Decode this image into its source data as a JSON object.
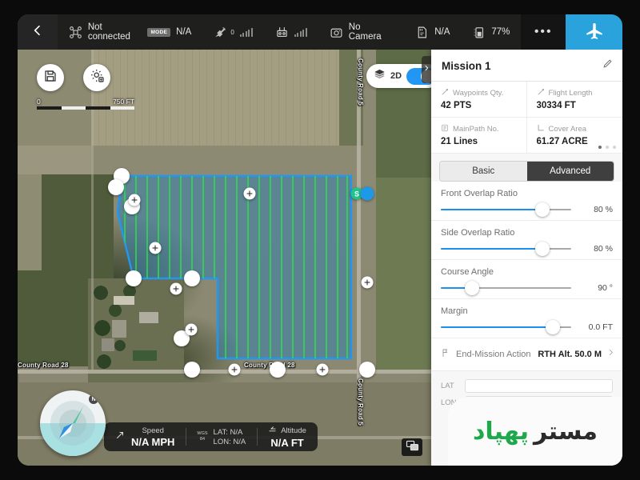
{
  "topbar": {
    "back_icon": "chevron-left-icon",
    "items": [
      {
        "icon": "drone-icon",
        "label": "Not connected",
        "badge": "MODE",
        "badge_value": "N/A"
      },
      {
        "icon": "satellite-icon",
        "label": "",
        "count": "0"
      },
      {
        "icon": "controller-icon",
        "label": ""
      },
      {
        "icon": "camera-icon",
        "label": "No Camera"
      },
      {
        "icon": "sdcard-icon",
        "label": "N/A"
      },
      {
        "icon": "battery-icon",
        "label": "77%"
      }
    ],
    "more_label": "•••",
    "fly_icon": "airplane-icon"
  },
  "map": {
    "save_icon": "save-icon",
    "settings_icon": "gear-settings-icon",
    "view_toggle": {
      "icon": "layers-icon",
      "label": "2D",
      "on": true
    },
    "route_toggle": {
      "icon": "route-icon",
      "label": "",
      "on": true
    },
    "locate_icon": "locate-target-icon",
    "compass_map_icon": "map-compass-icon",
    "orient_icon": "orientation-lock-icon",
    "scale": {
      "min": "0",
      "max": "750 FT"
    },
    "road_labels": [
      {
        "text": "County Road 5",
        "orientation": "vertical"
      },
      {
        "text": "County Road 28",
        "orientation": "horizontal"
      },
      {
        "text": "County Road 28",
        "orientation": "horizontal"
      },
      {
        "text": "County Road 5",
        "orientation": "vertical"
      }
    ],
    "survey": {
      "start_marker": "S",
      "fill_color": "#2f7fb0",
      "line_color": "#2de04a",
      "border_color": "#2196f3",
      "end_marker_color": "#1c9ae8"
    },
    "pip_icon": "picture-in-picture-icon"
  },
  "telemetry": {
    "speed": {
      "icon": "speed-icon",
      "label": "Speed",
      "value": "N/A MPH"
    },
    "coords": {
      "system": "WGS",
      "system2": "84",
      "lat": "LAT: N/A",
      "lon": "LON: N/A"
    },
    "altitude": {
      "icon": "altitude-icon",
      "label": "Altitude",
      "value": "N/A FT"
    },
    "compass_north": "N"
  },
  "panel": {
    "collapse_icon": "chevron-right-icon",
    "title": "Mission 1",
    "edit_icon": "pencil-icon",
    "stats": [
      {
        "icon": "waypoint-icon",
        "label": "Waypoints Qty.",
        "value": "42 PTS"
      },
      {
        "icon": "flightpath-icon",
        "label": "Flight Length",
        "value": "30334 FT"
      },
      {
        "icon": "mainpath-icon",
        "label": "MainPath No.",
        "value": "21 Lines"
      },
      {
        "icon": "area-icon",
        "label": "Cover Area",
        "value": "61.27 ACRE"
      }
    ],
    "page_dots": {
      "count": 3,
      "active": 0
    },
    "tabs": [
      {
        "label": "Basic",
        "active": false
      },
      {
        "label": "Advanced",
        "active": true
      }
    ],
    "sliders": [
      {
        "label": "Front Overlap Ratio",
        "value": "80 %",
        "percent": 78
      },
      {
        "label": "Side Overlap Ratio",
        "value": "80 %",
        "percent": 78
      },
      {
        "label": "Course Angle",
        "value": "90 °",
        "percent": 24
      },
      {
        "label": "Margin",
        "value": "0.0 FT",
        "percent": 86
      }
    ],
    "end_mission": {
      "icon": "flag-icon",
      "label": "End-Mission Action",
      "value": "RTH Alt. 50.0 M",
      "chevron": "chevron-right-icon"
    },
    "coords": {
      "lat_label": "LAT",
      "lon_label": "LON"
    }
  },
  "watermark": {
    "text": "مستر",
    "mark": "پهپاد"
  },
  "colors": {
    "accent_blue": "#1c8ff0",
    "fly_blue": "#2aa3dd",
    "toggle_on": "#2196f3",
    "tab_active_bg": "#3f3f3f",
    "survey_green": "#2de04a",
    "start_green": "#1fc48a",
    "watermark_green": "#1ea84c"
  }
}
